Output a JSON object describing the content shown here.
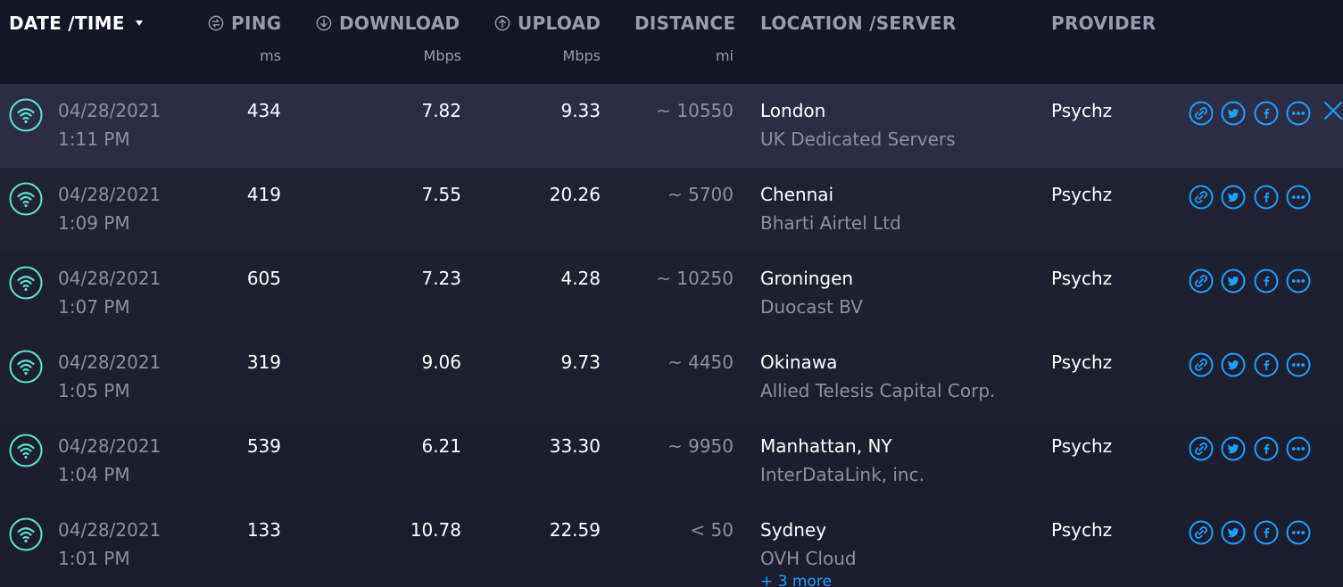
{
  "colors": {
    "accent": "#1ea0ff",
    "teal": "#5fe3d0",
    "header_bg": "#141526",
    "row_selected_bg": "#2c2c45"
  },
  "header": {
    "datetime_label": "DATE /TIME",
    "ping_label": "PING",
    "ping_unit": "ms",
    "download_label": "DOWNLOAD",
    "download_unit": "Mbps",
    "upload_label": "UPLOAD",
    "upload_unit": "Mbps",
    "distance_label": "DISTANCE",
    "distance_unit": "mi",
    "location_label": "LOCATION /SERVER",
    "provider_label": "PROVIDER"
  },
  "rows": [
    {
      "date": "04/28/2021",
      "time": "1:11 PM",
      "ping": "434",
      "download": "7.82",
      "upload": "9.33",
      "distance": "~ 10550",
      "location": "London",
      "server": "UK Dedicated Servers",
      "provider": "Psychz"
    },
    {
      "date": "04/28/2021",
      "time": "1:09 PM",
      "ping": "419",
      "download": "7.55",
      "upload": "20.26",
      "distance": "~ 5700",
      "location": "Chennai",
      "server": "Bharti Airtel Ltd",
      "provider": "Psychz"
    },
    {
      "date": "04/28/2021",
      "time": "1:07 PM",
      "ping": "605",
      "download": "7.23",
      "upload": "4.28",
      "distance": "~ 10250",
      "location": "Groningen",
      "server": "Duocast BV",
      "provider": "Psychz"
    },
    {
      "date": "04/28/2021",
      "time": "1:05 PM",
      "ping": "319",
      "download": "9.06",
      "upload": "9.73",
      "distance": "~ 4450",
      "location": "Okinawa",
      "server": "Allied Telesis Capital Corp.",
      "provider": "Psychz"
    },
    {
      "date": "04/28/2021",
      "time": "1:04 PM",
      "ping": "539",
      "download": "6.21",
      "upload": "33.30",
      "distance": "~ 9950",
      "location": "Manhattan, NY",
      "server": "InterDataLink, inc.",
      "provider": "Psychz"
    },
    {
      "date": "04/28/2021",
      "time": "1:01 PM",
      "ping": "133",
      "download": "10.78",
      "upload": "22.59",
      "distance": "< 50",
      "location": "Sydney",
      "server": "OVH Cloud",
      "provider": "Psychz"
    }
  ],
  "more_link": "+ 3 more",
  "icons": {
    "row_status": "wifi-icon",
    "actions": [
      "link-icon",
      "twitter-icon",
      "facebook-icon",
      "more-icon"
    ],
    "close": "close-icon"
  }
}
